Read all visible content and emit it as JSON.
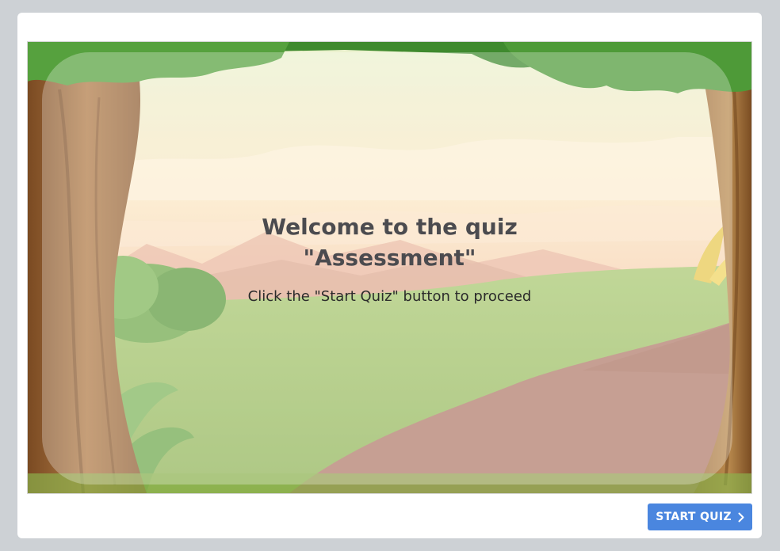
{
  "slide": {
    "title_line1": "Welcome to the quiz",
    "title_line2": "\"Assessment\"",
    "instruction": "Click the \"Start Quiz\" button to proceed"
  },
  "footer": {
    "start_button_label": "START QUIZ",
    "start_button_icon": "chevron-right-icon"
  },
  "colors": {
    "page_background": "#cdd1d5",
    "button_accent": "#4a86df",
    "title_text": "#4b4b4f"
  }
}
